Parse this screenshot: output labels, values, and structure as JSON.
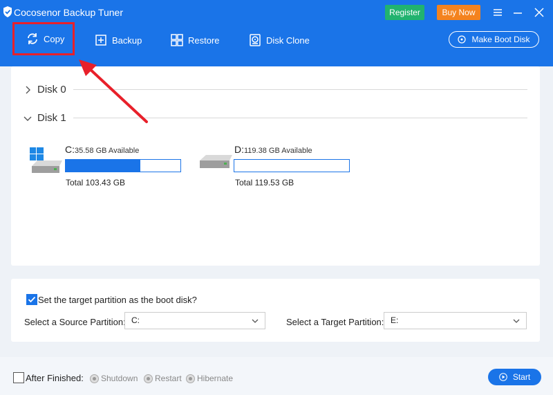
{
  "app": {
    "title": "Cocosenor Backup Tuner",
    "register_label": "Register",
    "buynow_label": "Buy Now"
  },
  "colors": {
    "header_blue": "#1a74e8",
    "register_green": "#21b36f",
    "buynow_orange": "#f4831f",
    "highlight_red": "#e8202a"
  },
  "toolbar": {
    "copy_label": "Copy",
    "backup_label": "Backup",
    "restore_label": "Restore",
    "clone_label": "Disk Clone",
    "bootdisk_label": "Make Boot Disk"
  },
  "disks": {
    "disk0_label": "Disk 0",
    "disk1_label": "Disk 1"
  },
  "partitions": [
    {
      "letter": "C:",
      "available": "35.58 GB Available",
      "total": "Total 103.43 GB",
      "used_fraction": 0.65
    },
    {
      "letter": "D:",
      "available": "119.38 GB Available",
      "total": "Total 119.53 GB",
      "used_fraction": 0.0
    }
  ],
  "options": {
    "boot_checkbox_label": "Set the target partition as the boot disk?",
    "source_label": "Select a Source Partition:",
    "source_value": "C:",
    "target_label": "Select a Target Partition:",
    "target_value": "E:"
  },
  "footer": {
    "after_label": "After Finished:",
    "shutdown_label": "Shutdown",
    "restart_label": "Restart",
    "hibernate_label": "Hibernate",
    "start_label": "Start"
  }
}
